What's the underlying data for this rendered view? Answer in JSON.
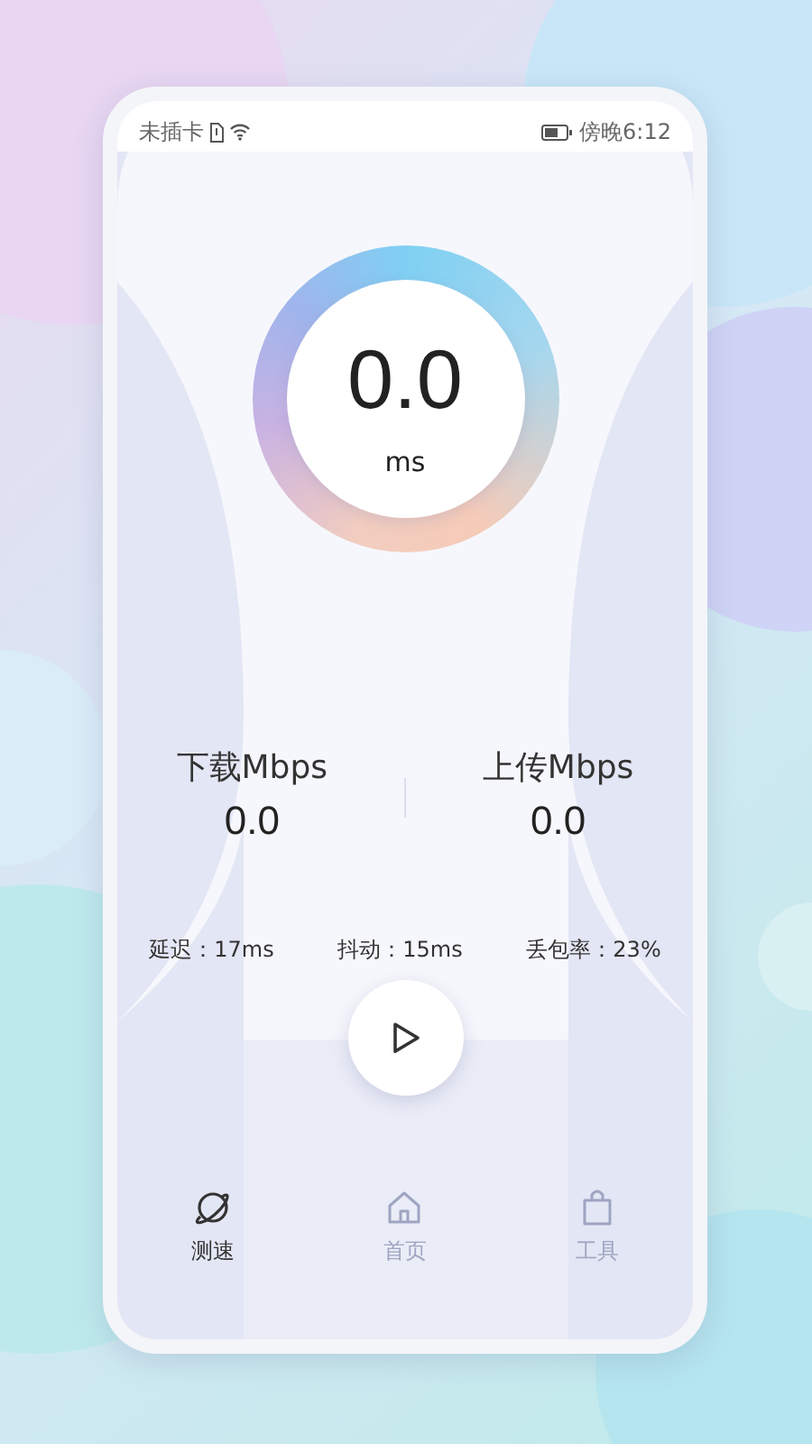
{
  "status_bar": {
    "carrier": "未插卡",
    "time": "傍晚6:12"
  },
  "gauge": {
    "value": "0.0",
    "unit": "ms"
  },
  "speeds": [
    {
      "label": "下载Mbps",
      "value": "0.0"
    },
    {
      "label": "上传Mbps",
      "value": "0.0"
    }
  ],
  "stats": [
    {
      "text": "延迟：17ms"
    },
    {
      "text": "抖动：15ms"
    },
    {
      "text": "丢包率：23%"
    }
  ],
  "tabs": [
    {
      "label": "测速",
      "selected": true
    },
    {
      "label": "首页",
      "selected": false
    },
    {
      "label": "工具",
      "selected": false
    }
  ]
}
